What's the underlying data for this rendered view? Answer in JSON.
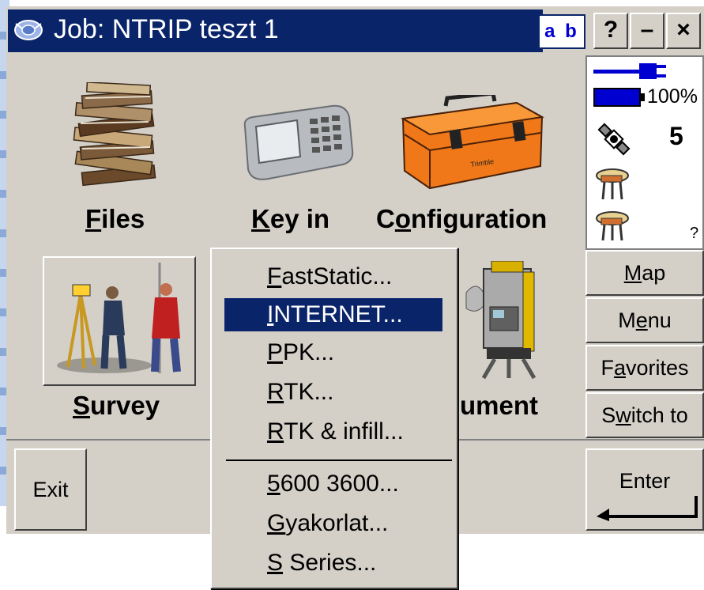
{
  "window": {
    "title": "Job: NTRIP teszt 1",
    "input_mode": "a b",
    "help_label": "?",
    "minimize_label": "–",
    "close_label": "×"
  },
  "status": {
    "battery_percent": "100%",
    "satellite_count": "5",
    "receiver2_status": "?"
  },
  "side_buttons": [
    {
      "label": "Map",
      "ul": "M",
      "rest": "ap"
    },
    {
      "label": "Menu",
      "pre": "M",
      "ul": "e",
      "rest": "nu"
    },
    {
      "label": "Favorites",
      "pre": "F",
      "ul": "a",
      "rest": "vorites"
    },
    {
      "label": "Switch to",
      "pre": "S",
      "ul": "w",
      "rest": "itch to"
    }
  ],
  "main_icons": {
    "files": {
      "ul": "F",
      "rest": "iles"
    },
    "keyin": {
      "ul": "K",
      "rest": "ey in"
    },
    "configuration": {
      "pre": "C",
      "ul": "o",
      "rest": "nfiguration"
    },
    "survey": {
      "ul": "S",
      "rest": "urvey"
    },
    "instrument_partial": "ument"
  },
  "bottom": {
    "exit_label": "Exit",
    "enter_label": "Enter"
  },
  "popup_menu": {
    "items": [
      {
        "label": "FastStatic...",
        "ul": "F",
        "rest": "astStatic..."
      },
      {
        "label": "INTERNET...",
        "ul": "I",
        "rest": "NTERNET...",
        "selected": true
      },
      {
        "label": "PPK...",
        "ul": "P",
        "rest": "PK..."
      },
      {
        "label": "RTK...",
        "ul": "R",
        "rest": "TK..."
      },
      {
        "label": "RTK & infill...",
        "ul": "R",
        "rest": "TK & infill..."
      },
      {
        "label": "5600 3600...",
        "ul": "5",
        "rest": "600 3600..."
      },
      {
        "label": "Gyakorlat...",
        "ul": "G",
        "rest": "yakorlat..."
      },
      {
        "label": "S Series...",
        "ul": "S",
        "rest": " Series..."
      }
    ]
  },
  "colors": {
    "titlebar": "#0a246a",
    "face": "#d4d0c8",
    "selection": "#0a246a",
    "battery": "#0000d0",
    "toolbox": "#f07818"
  }
}
